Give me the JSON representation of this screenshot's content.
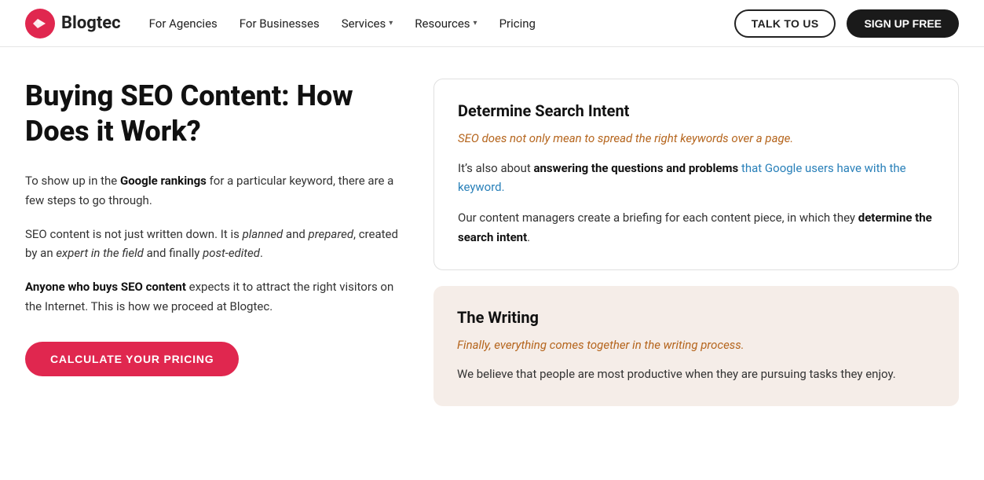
{
  "nav": {
    "logo_text": "Blogtec",
    "links": [
      {
        "label": "For Agencies",
        "has_dropdown": false
      },
      {
        "label": "For Businesses",
        "has_dropdown": false
      },
      {
        "label": "Services",
        "has_dropdown": true
      },
      {
        "label": "Resources",
        "has_dropdown": true
      },
      {
        "label": "Pricing",
        "has_dropdown": false
      }
    ],
    "talk_to_us": "TALK TO US",
    "sign_up_free": "SIGN UP FREE"
  },
  "left": {
    "title": "Buying SEO Content: How Does it Work?",
    "para1_prefix": "To show up in the ",
    "para1_bold": "Google rankings",
    "para1_suffix": " for a particular keyword, there are a few steps to go through.",
    "para2_plain1": "SEO content is not just written down. It is ",
    "para2_em1": "planned",
    "para2_plain2": " and ",
    "para2_em2": "prepared",
    "para2_plain3": ", created by an ",
    "para2_em3": "expert in the field",
    "para2_plain4": " and finally ",
    "para2_em4": "post-edited",
    "para2_plain5": ".",
    "para3_bold": "Anyone who buys SEO content",
    "para3_suffix": " expects it to attract the right visitors on the Internet. This is how we proceed at Blogtec.",
    "cta_button": "CALCULATE YOUR PRICING"
  },
  "right": {
    "card1": {
      "title": "Determine Search Intent",
      "subtitle": "SEO does not only mean to spread the right keywords over a page.",
      "body1_plain": "It’s also about ",
      "body1_bold": "answering the questions and problems",
      "body1_suffix": " that Google users have with the keyword.",
      "body2_plain": "Our content managers create a briefing for each content piece, in which they ",
      "body2_bold": "determine the search intent",
      "body2_suffix": "."
    },
    "card2": {
      "title": "The Writing",
      "subtitle_em": "Finally",
      "subtitle_suffix": ", everything comes together in the writing process.",
      "body1": "We believe that people are most productive when they are pursuing tasks they enjoy."
    }
  }
}
